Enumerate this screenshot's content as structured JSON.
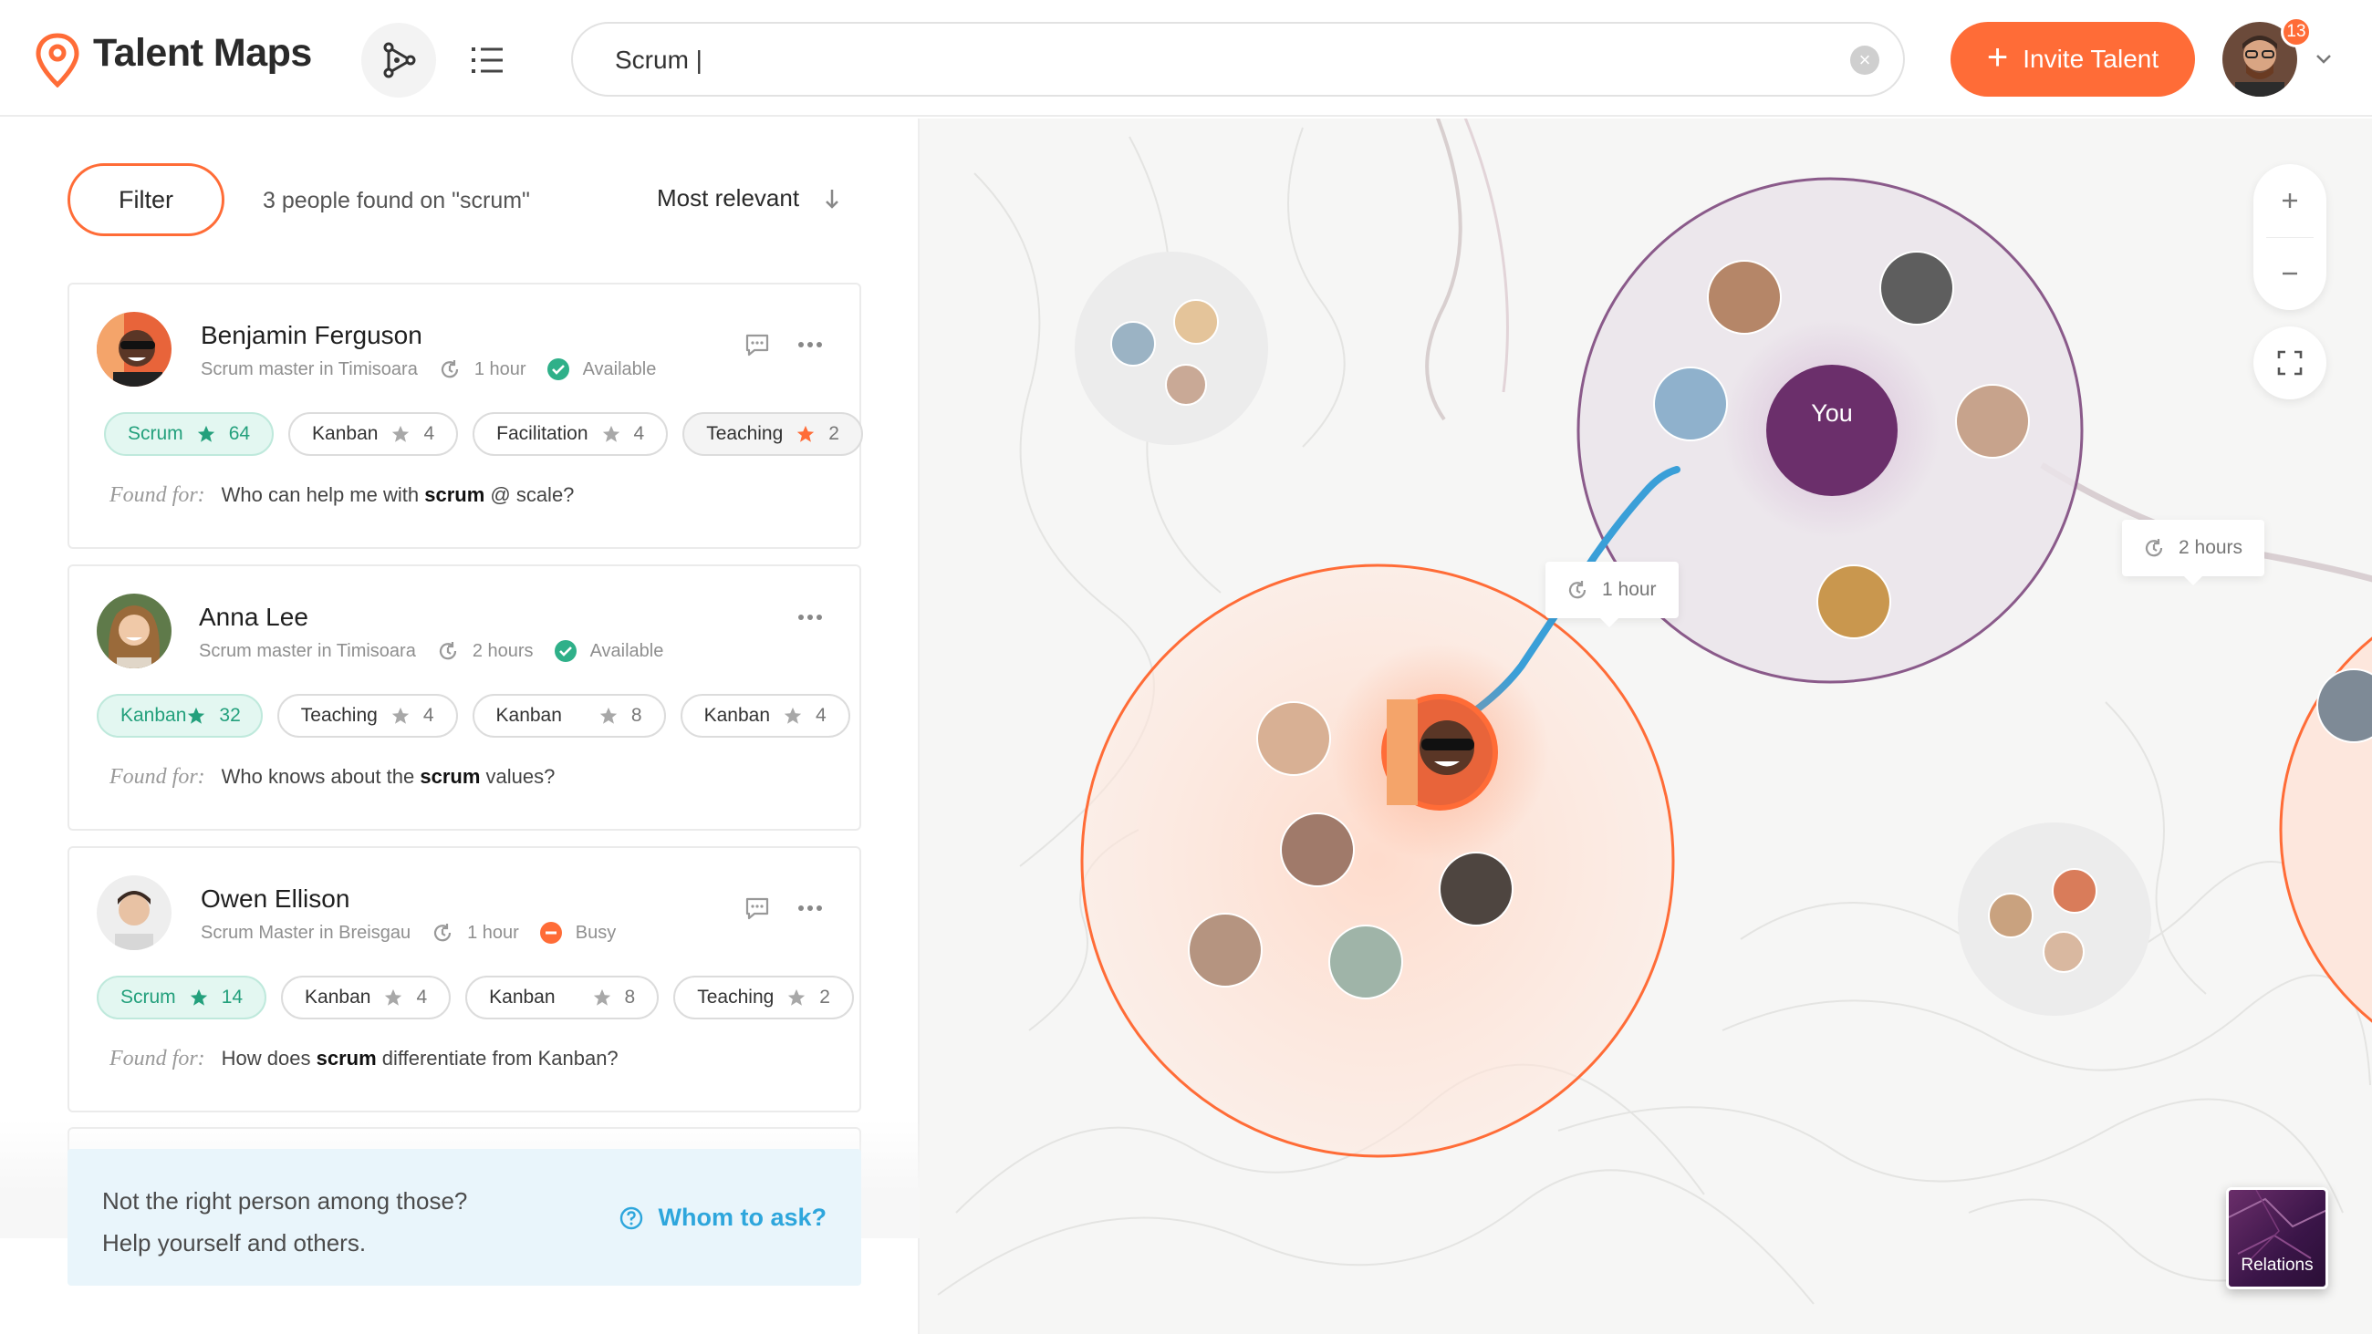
{
  "app": {
    "brand": "Talent Maps"
  },
  "search": {
    "value": "Scrum |"
  },
  "header": {
    "invite_label": "Invite Talent",
    "notifications": "13"
  },
  "panel": {
    "filter_label": "Filter",
    "results_text": "3 people found on \"scrum\"",
    "sort_label": "Most relevant",
    "found_label": "Found for:"
  },
  "people": [
    {
      "name": "Benjamin Ferguson",
      "role": "Scrum master in Timisoara",
      "time": "1 hour",
      "status": "Available",
      "status_color": "#2fb089",
      "query_pre": "Who can help me with ",
      "query_term": "scrum",
      "query_post": " @ scale?",
      "tags": [
        {
          "label": "Scrum",
          "count": "64",
          "star_color": "#23a07c"
        },
        {
          "label": "Kanban",
          "count": "4",
          "star_color": "#a8a8a8"
        },
        {
          "label": "Facilitation",
          "count": "4",
          "star_color": "#a8a8a8"
        },
        {
          "label": "Teaching",
          "count": "2",
          "star_color": "#ff6c37"
        }
      ]
    },
    {
      "name": "Anna Lee",
      "role": "Scrum master in Timisoara",
      "time": "2 hours",
      "status": "Available",
      "status_color": "#2fb089",
      "query_pre": "Who knows about the ",
      "query_term": "scrum",
      "query_post": " values?",
      "tags": [
        {
          "label": "Kanban",
          "count": "32",
          "star_color": "#23a07c"
        },
        {
          "label": "Teaching",
          "count": "4",
          "star_color": "#a8a8a8"
        },
        {
          "label": "Kanban",
          "count": "8",
          "star_color": "#a8a8a8"
        },
        {
          "label": "Kanban",
          "count": "4",
          "star_color": "#a8a8a8"
        }
      ]
    },
    {
      "name": "Owen Ellison",
      "role": "Scrum Master in Breisgau",
      "time": "1 hour",
      "status": "Busy",
      "status_color": "#ff6c37",
      "query_pre": "How does ",
      "query_term": "scrum",
      "query_post": " differentiate from Kanban?",
      "tags": [
        {
          "label": "Scrum",
          "count": "14",
          "star_color": "#23a07c"
        },
        {
          "label": "Kanban",
          "count": "4",
          "star_color": "#a8a8a8"
        },
        {
          "label": "Kanban",
          "count": "8",
          "star_color": "#a8a8a8"
        },
        {
          "label": "Teaching",
          "count": "2",
          "star_color": "#a8a8a8"
        }
      ]
    }
  ],
  "help": {
    "line1": "Not the right person among those?",
    "line2": "Help yourself and others.",
    "link": "Whom to ask?"
  },
  "map": {
    "you_label": "You",
    "tooltip_1": "1 hour",
    "tooltip_2": "2 hours",
    "relations_label": "Relations",
    "colors": {
      "you": "#6b2f6b",
      "orange": "#ff6c37",
      "link": "#3a9fd8"
    }
  }
}
